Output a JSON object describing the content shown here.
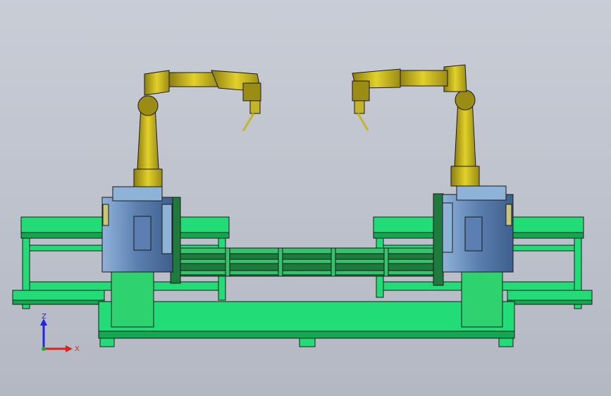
{
  "triad": {
    "z_label": "Z",
    "x_label": "X",
    "colors": {
      "z": "#2222ee",
      "x": "#dd2222",
      "y": "#22aa22"
    }
  },
  "colors": {
    "background_top": "#c9cdd6",
    "background_bottom": "#b4b8c2",
    "frame_green": "#22dd77",
    "frame_green_dark": "#13a852",
    "robot_yellow": "#d6c41e",
    "robot_yellow_dark": "#8c7e10",
    "positioner_blue": "#5a7fb0",
    "positioner_blue_light": "#8fb2d8",
    "pedestal_green": "#2ed36e",
    "outline": "#1a1a1a"
  },
  "icons": [
    "robot-arm-left-icon",
    "robot-arm-right-icon",
    "axis-triad-icon"
  ]
}
